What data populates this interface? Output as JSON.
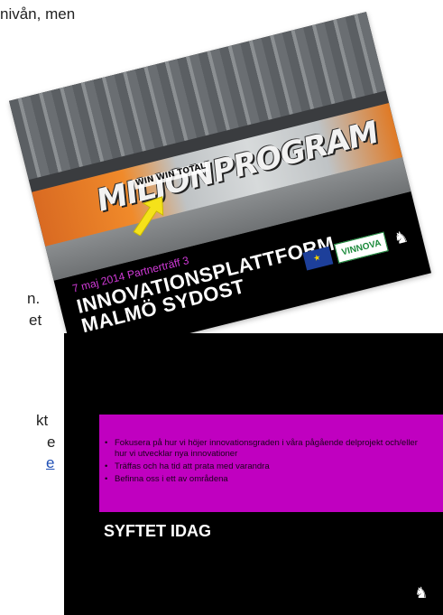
{
  "document": {
    "fragments": [
      "nivån, men",
      "n.",
      "et",
      "kt",
      "e",
      "e"
    ]
  },
  "slide1": {
    "graffiti_text": "MILJONPROGRAM",
    "graffiti_tag": "WIN WIN TOTAL",
    "date_line": "7 maj 2014 Partnerträff 3",
    "title_line1": "INNOVATIONSPLATTFORM",
    "title_line2": "MALMÖ SYDOST",
    "logos": [
      "eu-flag-logo",
      "VINNOVA",
      "crest-logo"
    ],
    "colors": {
      "date": "#d23ad9",
      "title": "#ffffff",
      "background": "#000000",
      "arrow": "#f5e21a"
    }
  },
  "slide2": {
    "bullets": [
      "Fokusera på hur vi höjer innovationsgraden i våra pågående delprojekt och/eller hur vi utvecklar nya innovationer",
      "Träffas och ha tid att prata med varandra",
      "Befinna oss i ett av områdena"
    ],
    "title": "SYFTET IDAG",
    "colors": {
      "box": "#c000c0",
      "background": "#000000",
      "title": "#ffffff"
    }
  }
}
